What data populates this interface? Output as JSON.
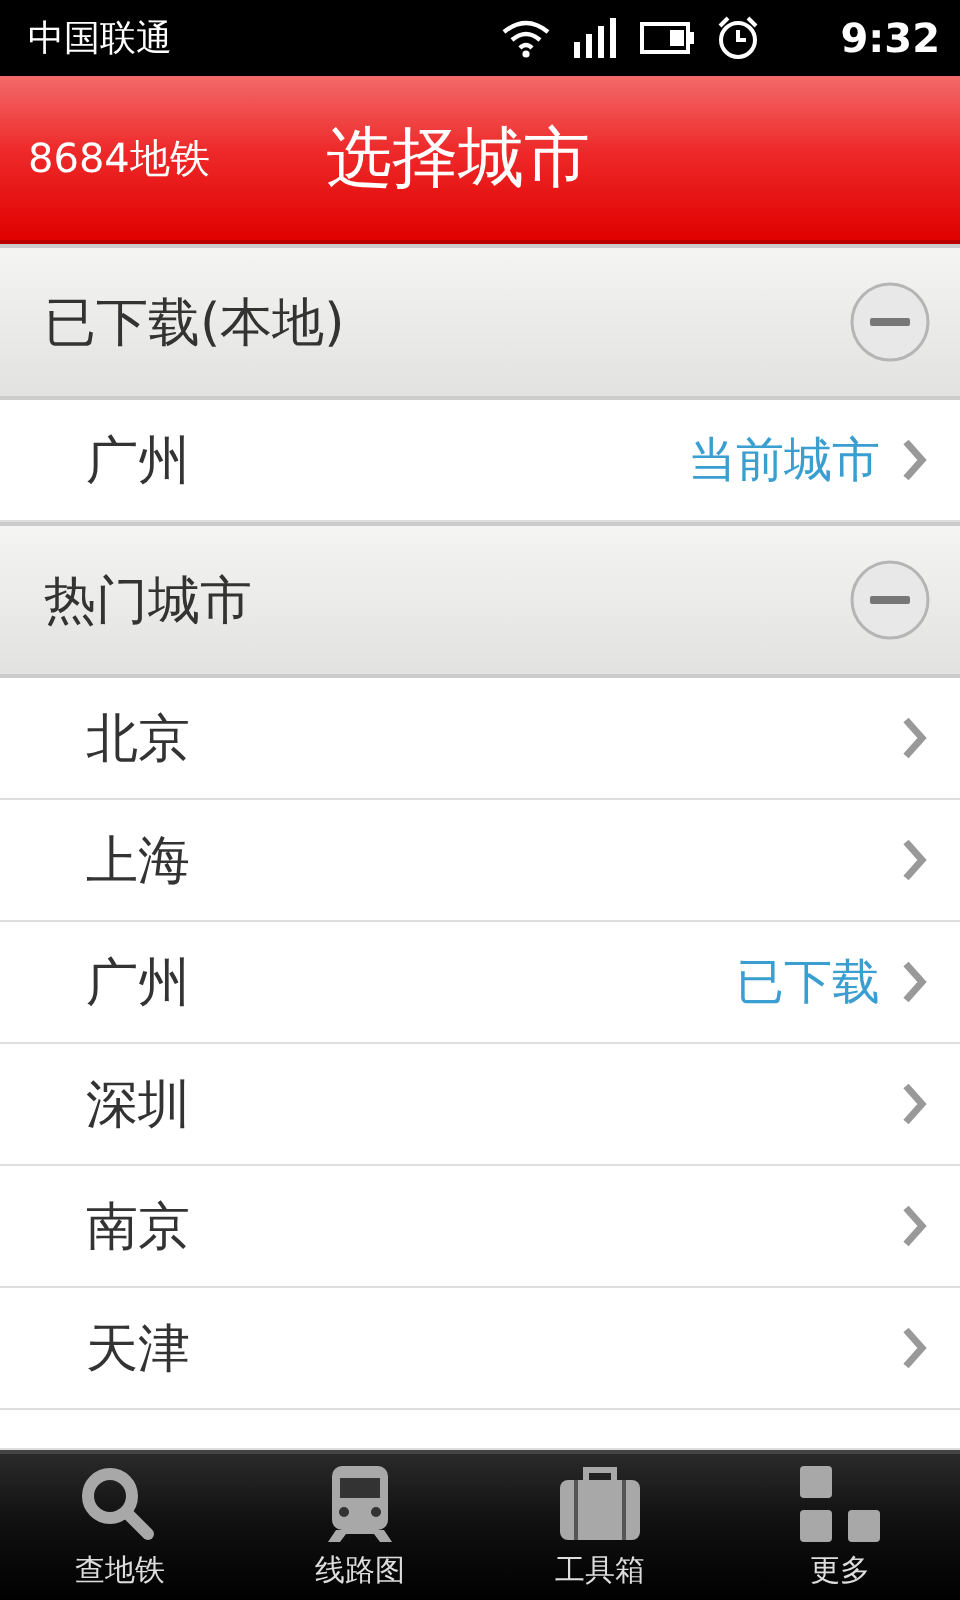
{
  "status_bar": {
    "carrier": "中国联通",
    "time": "9:32"
  },
  "header": {
    "app_name": "8684地铁",
    "title": "选择城市"
  },
  "sections": [
    {
      "title": "已下载(本地)",
      "expanded": true,
      "cities": [
        {
          "name": "广州",
          "tag": "当前城市"
        }
      ]
    },
    {
      "title": "热门城市",
      "expanded": true,
      "cities": [
        {
          "name": "北京"
        },
        {
          "name": "上海"
        },
        {
          "name": "广州",
          "tag": "已下载"
        },
        {
          "name": "深圳"
        },
        {
          "name": "南京"
        },
        {
          "name": "天津"
        }
      ]
    }
  ],
  "tab_bar": [
    {
      "label": "查地铁",
      "kind": "search"
    },
    {
      "label": "线路图",
      "kind": "train"
    },
    {
      "label": "工具箱",
      "kind": "toolbox"
    },
    {
      "label": "更多",
      "kind": "more"
    }
  ]
}
